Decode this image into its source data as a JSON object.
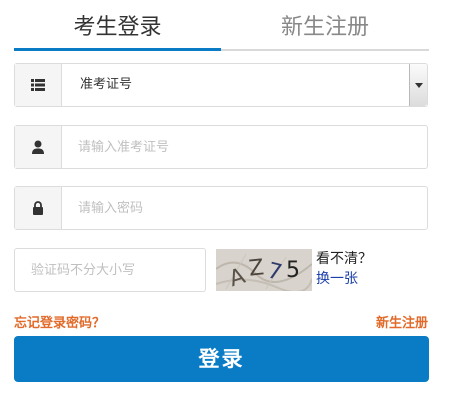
{
  "tabs": {
    "login": "考生登录",
    "register": "新生注册"
  },
  "id_type": {
    "value": "准考证号"
  },
  "username": {
    "placeholder": "请输入准考证号"
  },
  "password": {
    "placeholder": "请输入密码"
  },
  "captcha": {
    "placeholder": "验证码不分大小写",
    "image_text": "AZ75",
    "help_text": "看不清？",
    "refresh_text": "换一张"
  },
  "links": {
    "forgot_password": "忘记登录密码？",
    "register": "新生注册"
  },
  "submit": {
    "label": "登录"
  },
  "colors": {
    "accent": "#0a7cc5",
    "link_orange": "#e26b2c",
    "refresh_link": "#1a3fa8"
  },
  "icons": {
    "id_type": "list-icon",
    "username": "user-icon",
    "password": "lock-icon",
    "select": "chevron-down-icon"
  }
}
